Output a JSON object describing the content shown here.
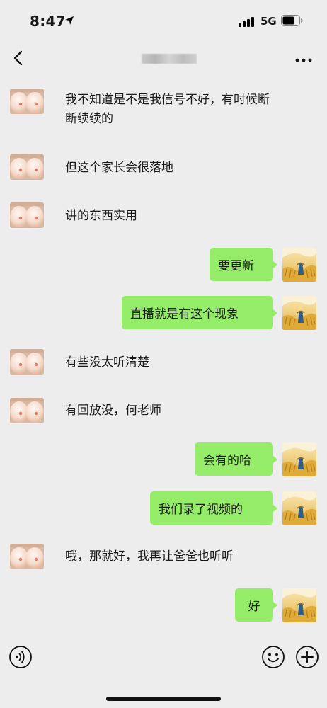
{
  "status": {
    "time": "8:47",
    "network": "5G"
  },
  "header": {
    "title": ""
  },
  "messages": [
    {
      "side": "left",
      "text": "我不知道是不是我信号不好，有时候断断续续的"
    },
    {
      "side": "left",
      "text": "但这个家长会很落地"
    },
    {
      "side": "left",
      "text": "讲的东西实用"
    },
    {
      "side": "right",
      "text": "要更新"
    },
    {
      "side": "right",
      "text": "直播就是有这个现象"
    },
    {
      "side": "left",
      "text": "有些没太听清楚"
    },
    {
      "side": "left",
      "text": "有回放没，何老师"
    },
    {
      "side": "right",
      "text": "会有的哈"
    },
    {
      "side": "right",
      "text": "我们录了视频的"
    },
    {
      "side": "left",
      "text": "哦，那就好，我再让爸爸也听听"
    },
    {
      "side": "right",
      "text": "好"
    }
  ],
  "input_bar": {
    "voice_icon": "voice-icon",
    "emoji_icon": "emoji-icon",
    "plus_icon": "plus-icon"
  },
  "colors": {
    "background": "#ededed",
    "bubble_self": "#95ec69",
    "text": "#1a1a1a"
  }
}
